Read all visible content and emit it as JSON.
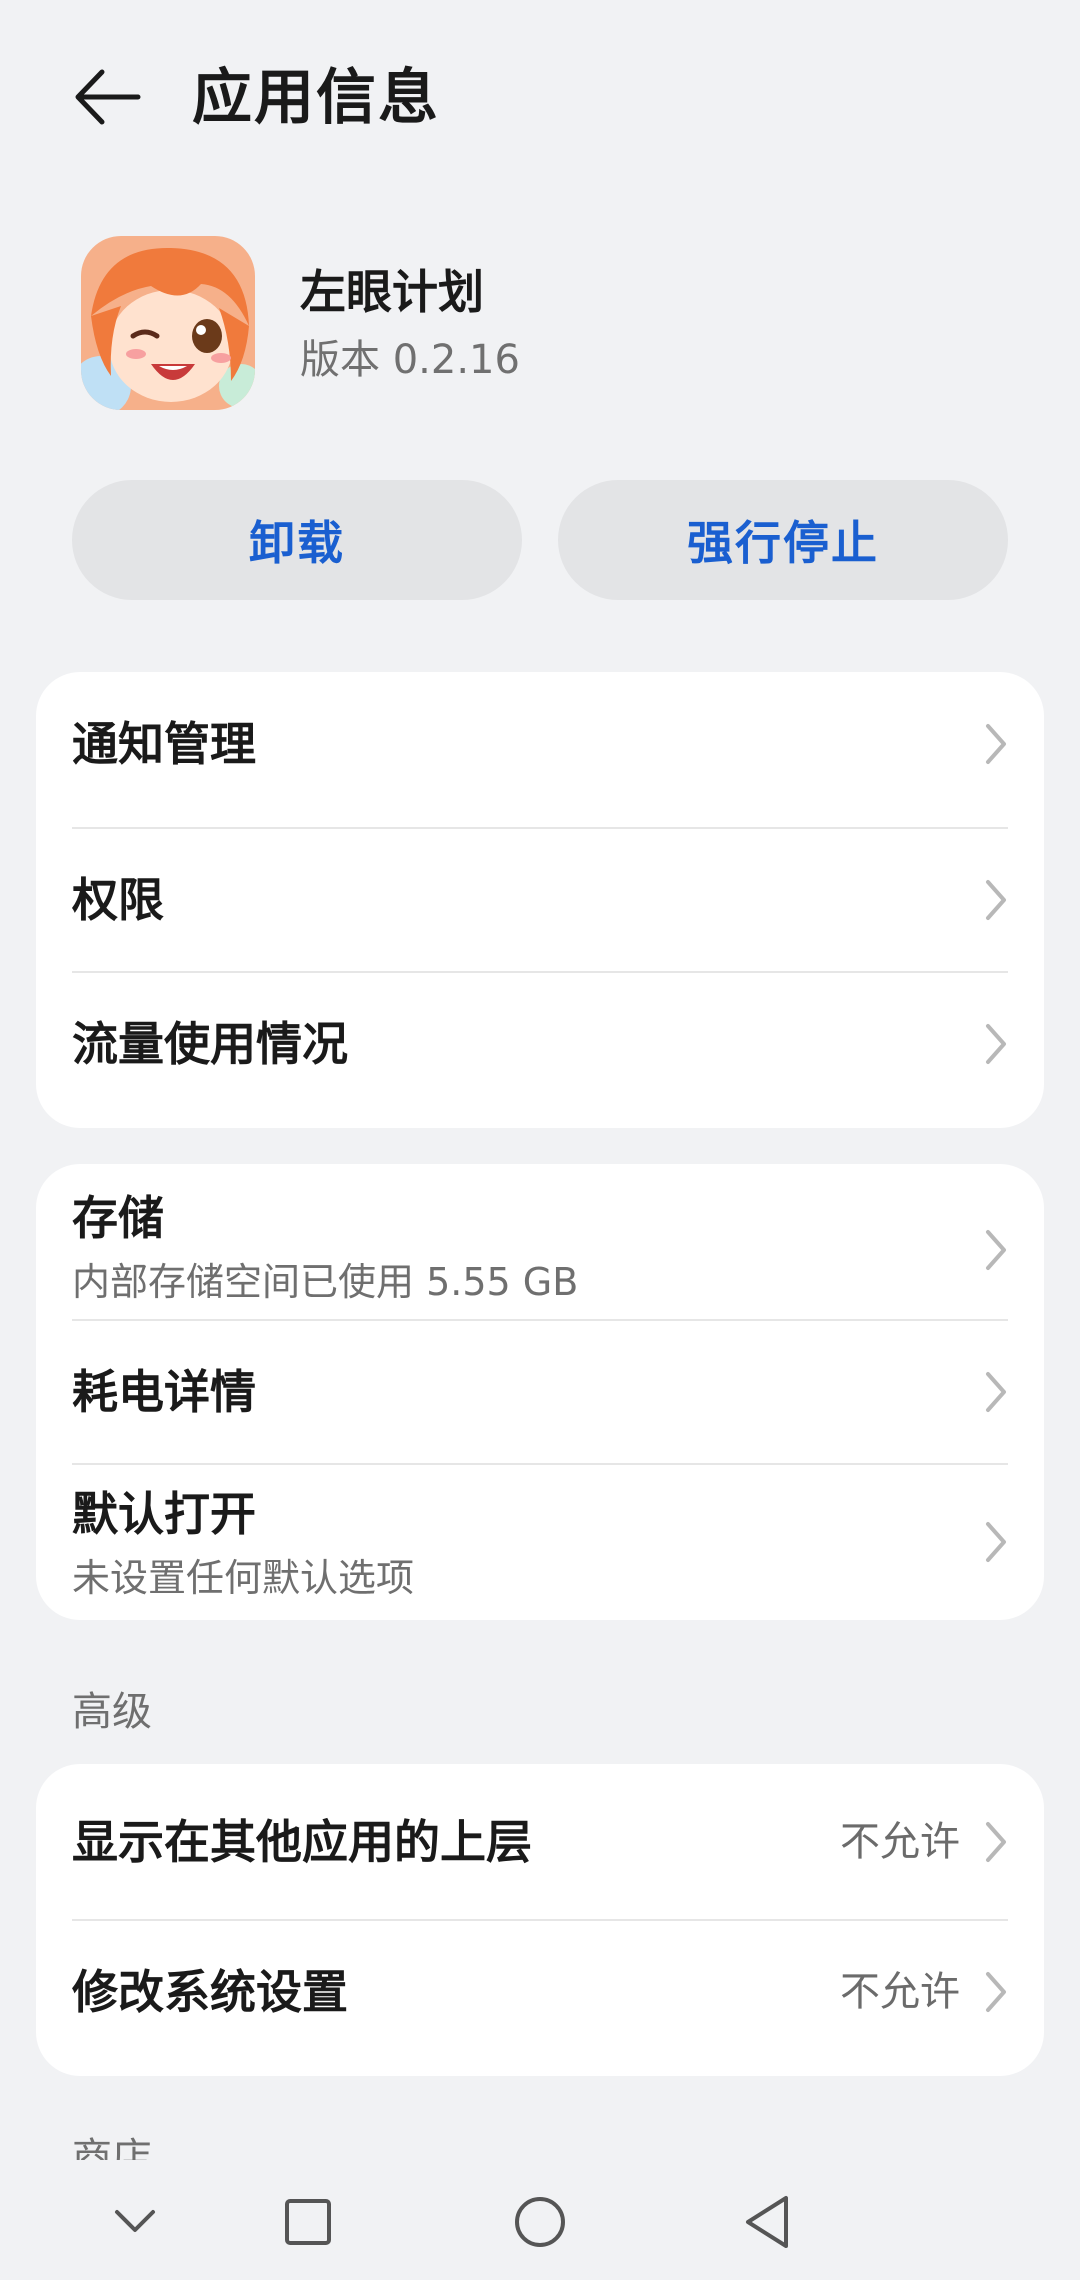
{
  "header": {
    "title": "应用信息",
    "back_icon": "arrow-left-icon"
  },
  "app": {
    "name": "左眼计划",
    "version": "版本 0.2.16"
  },
  "actions": {
    "uninstall_label": "卸载",
    "force_stop_label": "强行停止"
  },
  "group1": {
    "items": [
      {
        "title": "通知管理"
      },
      {
        "title": "权限"
      },
      {
        "title": "流量使用情况"
      }
    ]
  },
  "group2": {
    "items": [
      {
        "title": "存储",
        "subtitle": "内部存储空间已使用 5.55 GB"
      },
      {
        "title": "耗电详情"
      },
      {
        "title": "默认打开",
        "subtitle": "未设置任何默认选项"
      }
    ]
  },
  "advanced": {
    "label": "高级",
    "items": [
      {
        "title": "显示在其他应用的上层",
        "value": "不允许"
      },
      {
        "title": "修改系统设置",
        "value": "不允许"
      }
    ]
  },
  "next_section_label": "商店",
  "navbar": {
    "icons": [
      "chevron-down-icon",
      "square-icon",
      "circle-icon",
      "triangle-back-icon"
    ]
  },
  "colors": {
    "accent": "#1a5fd0",
    "background": "#f1f2f4",
    "card": "#ffffff"
  }
}
